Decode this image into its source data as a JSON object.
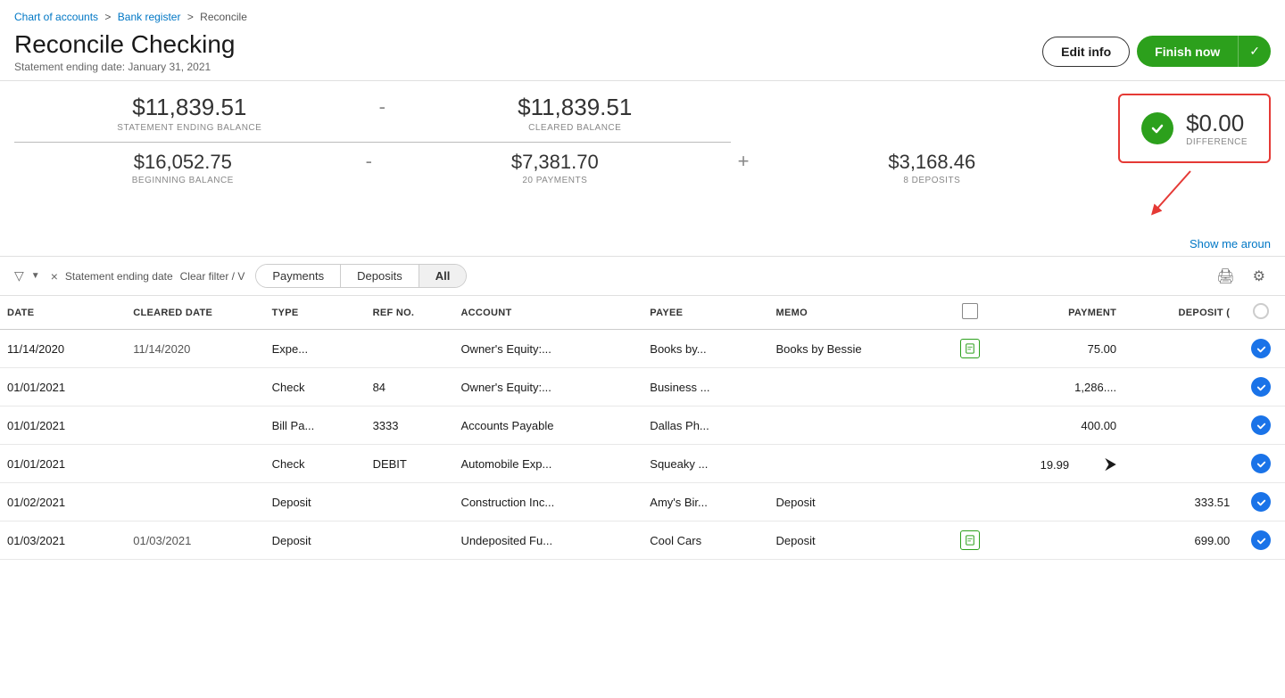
{
  "breadcrumb": {
    "part1": "Chart of accounts",
    "sep1": ">",
    "part2": "Bank register",
    "sep2": ">",
    "part3": "Reconcile"
  },
  "page": {
    "title": "Reconcile   Checking",
    "subtitle": "Statement ending date: January 31, 2021"
  },
  "actions": {
    "edit_info": "Edit info",
    "finish_now": "Finish now"
  },
  "summary": {
    "statement_ending_balance": "$11,839.51",
    "statement_ending_balance_label": "STATEMENT ENDING BALANCE",
    "cleared_balance": "$11,839.51",
    "cleared_balance_label": "CLEARED BALANCE",
    "beginning_balance": "$16,052.75",
    "beginning_balance_label": "BEGINNING BALANCE",
    "payments": "$7,381.70",
    "payments_label": "20 PAYMENTS",
    "deposits": "$3,168.46",
    "deposits_label": "8 DEPOSITS",
    "difference": "$0.00",
    "difference_label": "DIFFERENCE"
  },
  "show_me": "Show me aroun",
  "filters": {
    "statement_ending_date": "Statement ending date",
    "clear_filter": "Clear filter / V"
  },
  "tabs": [
    {
      "label": "Payments",
      "active": false
    },
    {
      "label": "Deposits",
      "active": false
    },
    {
      "label": "All",
      "active": true
    }
  ],
  "table": {
    "headers": [
      "DATE",
      "CLEARED DATE",
      "TYPE",
      "REF NO.",
      "ACCOUNT",
      "PAYEE",
      "MEMO",
      "",
      "PAYMENT",
      "DEPOSIT (",
      ""
    ],
    "rows": [
      {
        "date": "11/14/2020",
        "cleared_date": "11/14/2020",
        "type": "Expe...",
        "ref_no": "",
        "account": "Owner's Equity:...",
        "payee": "Books by...",
        "memo": "Books by Bessie",
        "has_icon": true,
        "payment": "75.00",
        "deposit": "",
        "checked": true
      },
      {
        "date": "01/01/2021",
        "cleared_date": "",
        "type": "Check",
        "ref_no": "84",
        "account": "Owner's Equity:...",
        "payee": "Business ...",
        "memo": "",
        "has_icon": false,
        "payment": "1,286....",
        "deposit": "",
        "checked": true
      },
      {
        "date": "01/01/2021",
        "cleared_date": "",
        "type": "Bill Pa...",
        "ref_no": "3333",
        "account": "Accounts Payable",
        "payee": "Dallas Ph...",
        "memo": "",
        "has_icon": false,
        "payment": "400.00",
        "deposit": "",
        "checked": true
      },
      {
        "date": "01/01/2021",
        "cleared_date": "",
        "type": "Check",
        "ref_no": "DEBIT",
        "account": "Automobile Exp...",
        "payee": "Squeaky ...",
        "memo": "",
        "has_icon": false,
        "payment": "19.99",
        "deposit": "",
        "checked": true
      },
      {
        "date": "01/02/2021",
        "cleared_date": "",
        "type": "Deposit",
        "ref_no": "",
        "account": "Construction Inc...",
        "payee": "Amy's Bir...",
        "memo": "Deposit",
        "has_icon": false,
        "payment": "",
        "deposit": "333.51",
        "checked": true
      },
      {
        "date": "01/03/2021",
        "cleared_date": "01/03/2021",
        "type": "Deposit",
        "ref_no": "",
        "account": "Undeposited Fu...",
        "payee": "Cool Cars",
        "memo": "Deposit",
        "has_icon": true,
        "payment": "",
        "deposit": "699.00",
        "checked": true
      }
    ]
  }
}
